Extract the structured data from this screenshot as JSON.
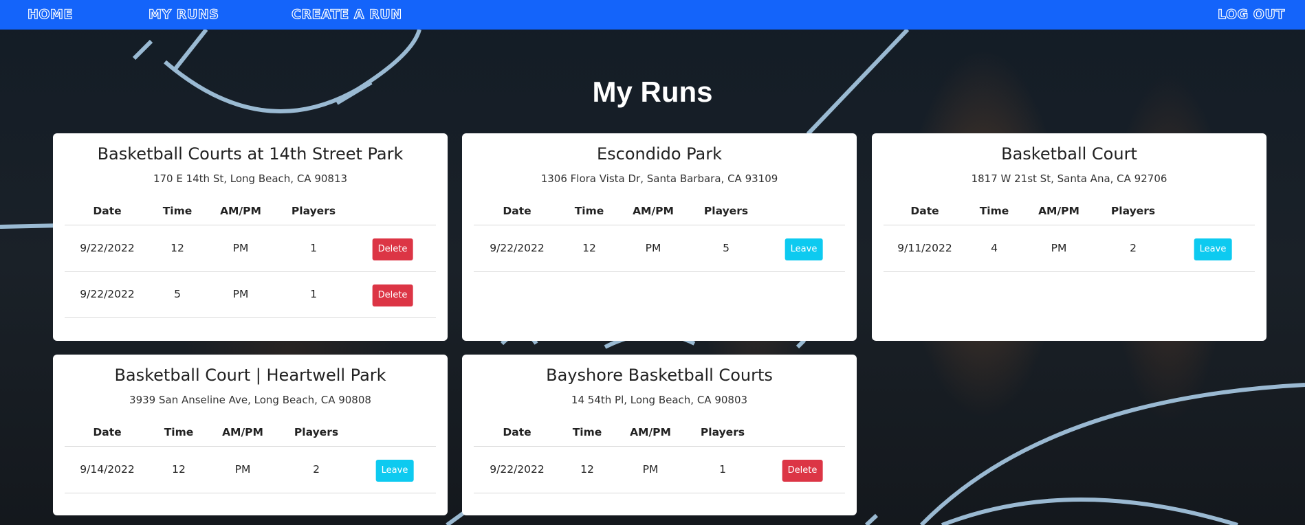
{
  "nav": {
    "home": "HOME",
    "my_runs": "MY RUNS",
    "create_run": "CREATE A RUN",
    "logout": "LOG OUT"
  },
  "page_title": "My Runs",
  "table_headers": {
    "date": "Date",
    "time": "Time",
    "ampm": "AM/PM",
    "players": "Players"
  },
  "colors": {
    "nav": "#1464fa",
    "delete": "#dc3545",
    "leave": "#0dcaf0"
  },
  "cards": [
    {
      "name": "Basketball Courts at 14th Street Park",
      "address": "170 E 14th St, Long Beach, CA 90813",
      "runs": [
        {
          "date": "9/22/2022",
          "time": "12",
          "ampm": "PM",
          "players": "1",
          "action": "Delete"
        },
        {
          "date": "9/22/2022",
          "time": "5",
          "ampm": "PM",
          "players": "1",
          "action": "Delete"
        }
      ]
    },
    {
      "name": "Escondido Park",
      "address": "1306 Flora Vista Dr, Santa Barbara, CA 93109",
      "runs": [
        {
          "date": "9/22/2022",
          "time": "12",
          "ampm": "PM",
          "players": "5",
          "action": "Leave"
        }
      ]
    },
    {
      "name": "Basketball Court",
      "address": "1817 W 21st St, Santa Ana, CA 92706",
      "runs": [
        {
          "date": "9/11/2022",
          "time": "4",
          "ampm": "PM",
          "players": "2",
          "action": "Leave"
        }
      ]
    },
    {
      "name": "Basketball Court | Heartwell Park",
      "address": "3939 San Anseline Ave, Long Beach, CA 90808",
      "runs": [
        {
          "date": "9/14/2022",
          "time": "12",
          "ampm": "PM",
          "players": "2",
          "action": "Leave"
        }
      ]
    },
    {
      "name": "Bayshore Basketball Courts",
      "address": "14 54th Pl, Long Beach, CA 90803",
      "runs": [
        {
          "date": "9/22/2022",
          "time": "12",
          "ampm": "PM",
          "players": "1",
          "action": "Delete"
        }
      ]
    }
  ]
}
